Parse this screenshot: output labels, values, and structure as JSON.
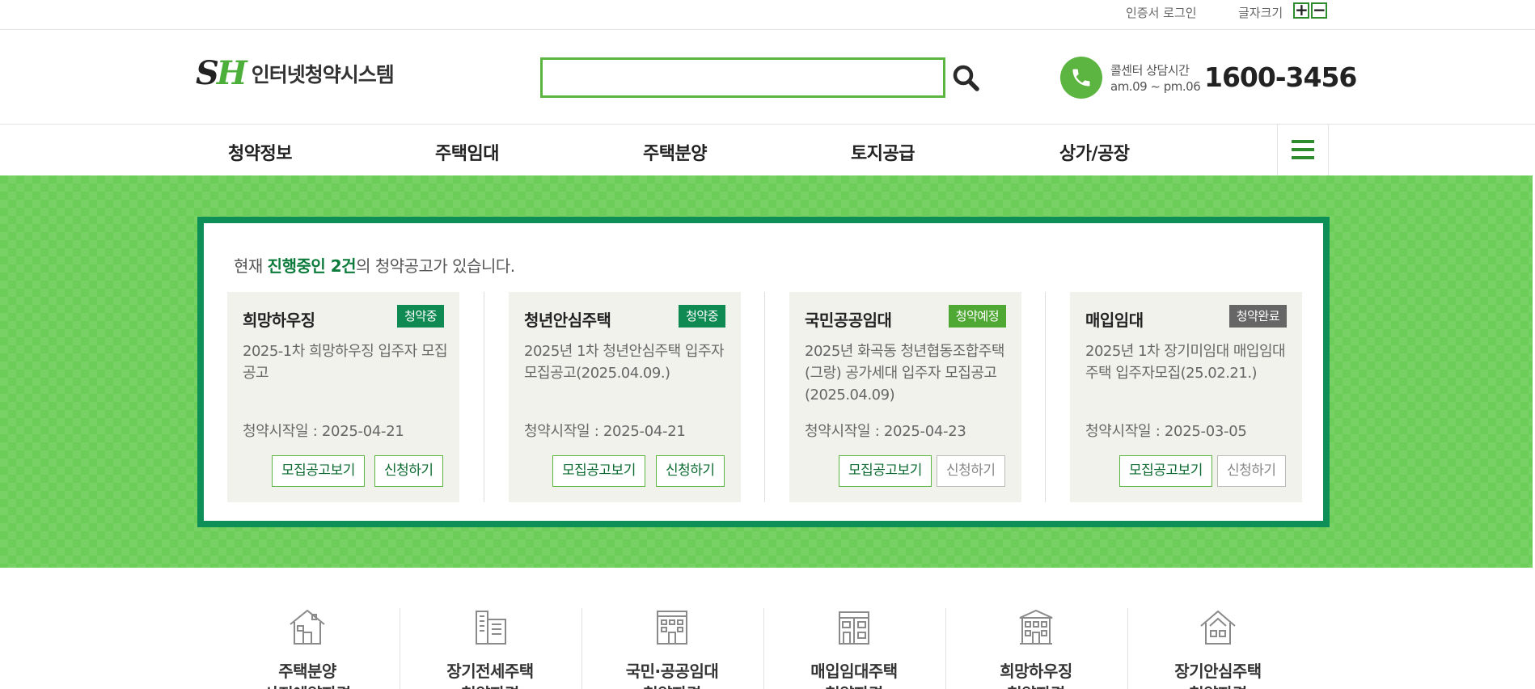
{
  "util": {
    "login_label": "인증서 로그인",
    "font_size_label": "글자크기",
    "plus_label": "+",
    "minus_label": "−"
  },
  "header": {
    "logo_mark_s": "S",
    "logo_mark_h": "H",
    "logo_text": "인터넷청약시스템",
    "search": {
      "value": "",
      "placeholder": "",
      "icon": "search-icon"
    },
    "call": {
      "label_line1": "콜센터 상담시간",
      "label_line2": "am.09 ~ pm.06",
      "number": "1600-3456",
      "icon": "phone-icon"
    }
  },
  "nav": {
    "items": [
      "청약정보",
      "주택임대",
      "주택분양",
      "토지공급",
      "상가/공장"
    ],
    "menu_icon": "hamburger-menu-icon"
  },
  "hero": {
    "notice_prefix": "현재 ",
    "notice_highlight": "진행중인 2건",
    "notice_suffix": "의 청약공고가 있습니다.",
    "cards": [
      {
        "title": "희망하우징",
        "badge": "청약중",
        "desc": "2025-1차 희망하우징 입주자 모집공고",
        "date": "청약시작일 : 2025-04-21",
        "btn_view": "모집공고보기",
        "btn_apply": "신청하기"
      },
      {
        "title": "청년안심주택",
        "badge": "청약중",
        "desc": "2025년 1차 청년안심주택 입주자 모집공고(2025.04.09.)",
        "date": "청약시작일 : 2025-04-21",
        "btn_view": "모집공고보기",
        "btn_apply": "신청하기"
      },
      {
        "title": "국민공공임대",
        "badge": "청약예정",
        "desc": "2025년 화곡동 청년협동조합주택(그랑) 공가세대 입주자 모집공고(2025.04.09)",
        "date": "청약시작일 : 2025-04-23",
        "btn_view": "모집공고보기",
        "btn_apply": "신청하기"
      },
      {
        "title": "매입임대",
        "badge": "청약완료",
        "desc": "2025년 1차 장기미임대 매입임대주택 입주자모집(25.02.21.)",
        "date": "청약시작일 : 2025-03-05",
        "btn_view": "모집공고보기",
        "btn_apply": "신청하기"
      }
    ]
  },
  "shortcuts": [
    {
      "line1": "주택분양",
      "line2": "사전예약자격",
      "icon": "house-icon"
    },
    {
      "line1": "장기전세주택",
      "line2": "청약자격",
      "icon": "apartment-icon"
    },
    {
      "line1": "국민·공공임대",
      "line2": "청약자격",
      "icon": "building-icon"
    },
    {
      "line1": "매입임대주택",
      "line2": "청약자격",
      "icon": "townhouse-icon"
    },
    {
      "line1": "희망하우징",
      "line2": "청약자격",
      "icon": "dormitory-icon"
    },
    {
      "line1": "장기안심주택",
      "line2": "청약자격",
      "icon": "home-icon"
    }
  ],
  "colors": {
    "brand_green": "#5cb540",
    "panel_border": "#0d8f57",
    "hero_bg": "#6ccd58",
    "badge_ongoing": "#0e8a52",
    "badge_planned": "#4fa834",
    "badge_done": "#666666"
  }
}
